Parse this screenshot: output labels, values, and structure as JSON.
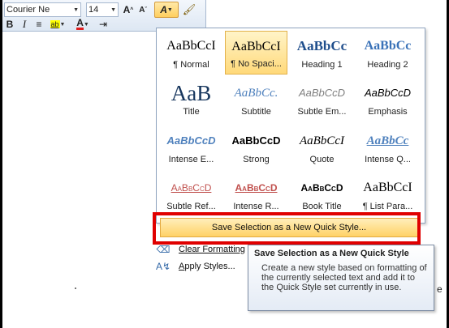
{
  "toolbar": {
    "font_name": "Courier Ne",
    "font_size": "14",
    "grow_label": "A",
    "shrink_label": "A",
    "styles_label": "A",
    "bold_label": "B",
    "italic_label": "I",
    "center_label": "≡",
    "highlight_label": "ab",
    "font_color_label": "A",
    "indent_label": "⇥"
  },
  "gallery": {
    "styles": [
      {
        "preview": "AaBbCcI",
        "label": "¶ Normal",
        "selected": false
      },
      {
        "preview": "AaBbCcI",
        "label": "¶ No Spaci...",
        "selected": true
      },
      {
        "preview": "AaBbCc",
        "label": "Heading 1",
        "selected": false
      },
      {
        "preview": "AaBbCc",
        "label": "Heading 2",
        "selected": false
      },
      {
        "preview": "AaB",
        "label": "Title",
        "selected": false
      },
      {
        "preview": "AaBbCc.",
        "label": "Subtitle",
        "selected": false
      },
      {
        "preview": "AaBbCcD",
        "label": "Subtle Em...",
        "selected": false
      },
      {
        "preview": "AaBbCcD",
        "label": "Emphasis",
        "selected": false
      },
      {
        "preview": "AaBbCcD",
        "label": "Intense E...",
        "selected": false
      },
      {
        "preview": "AaBbCcD",
        "label": "Strong",
        "selected": false
      },
      {
        "preview": "AaBbCcI",
        "label": "Quote",
        "selected": false
      },
      {
        "preview": "AaBbCc",
        "label": "Intense Q...",
        "selected": false
      },
      {
        "preview": "AaBbCcD",
        "label": "Subtle Ref...",
        "selected": false
      },
      {
        "preview": "AaBbCcD",
        "label": "Intense R...",
        "selected": false
      },
      {
        "preview": "AaBbCcD",
        "label": "Book Title",
        "selected": false
      },
      {
        "preview": "AaBbCcI",
        "label": "¶ List Para...",
        "selected": false
      }
    ]
  },
  "menu": {
    "save_selection": "Save Selection as a New Quick Style...",
    "clear_formatting": "Clear Formatting",
    "apply_styles_key": "A",
    "apply_styles_rest": "pply Styles..."
  },
  "tooltip": {
    "title": "Save Selection as a New Quick Style",
    "body": "Create a new style based on formatting of the currently selected text and add it to the Quick Style set currently in use."
  },
  "document": {
    "edge_text": "e"
  },
  "colors": {
    "highlight_border": "#e00000",
    "hover_fill": "#ffd266",
    "heading_blue": "#1f4e8c"
  }
}
